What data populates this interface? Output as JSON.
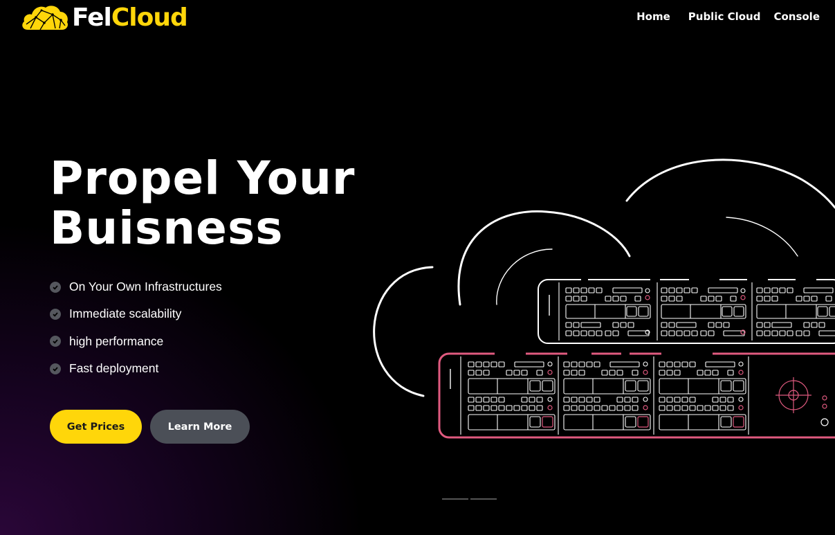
{
  "brand": {
    "name_part1": "Fel",
    "name_part2": "Cloud",
    "accent_color": "#ffd60a",
    "logo_icon": "cloud-network-icon"
  },
  "nav": {
    "items": [
      {
        "label": "Home"
      },
      {
        "label": "Public Cloud"
      },
      {
        "label": "Console"
      }
    ]
  },
  "hero": {
    "title_line1": "Propel Your",
    "title_line2": "Buisness",
    "features": [
      {
        "label": "On Your Own Infrastructures",
        "icon": "check-circle-icon"
      },
      {
        "label": "Immediate scalability",
        "icon": "check-circle-icon"
      },
      {
        "label": "high performance",
        "icon": "check-circle-icon"
      },
      {
        "label": "Fast deployment",
        "icon": "check-circle-icon"
      }
    ],
    "primary_button": "Get Prices",
    "secondary_button": "Learn More",
    "illustration": "cloud-server-rack-illustration"
  },
  "colors": {
    "background": "#000000",
    "gradient": "#2a0638",
    "button_primary": "#ffd60a",
    "button_secondary": "#4b4f57",
    "server_highlight": "#e05a7f"
  }
}
